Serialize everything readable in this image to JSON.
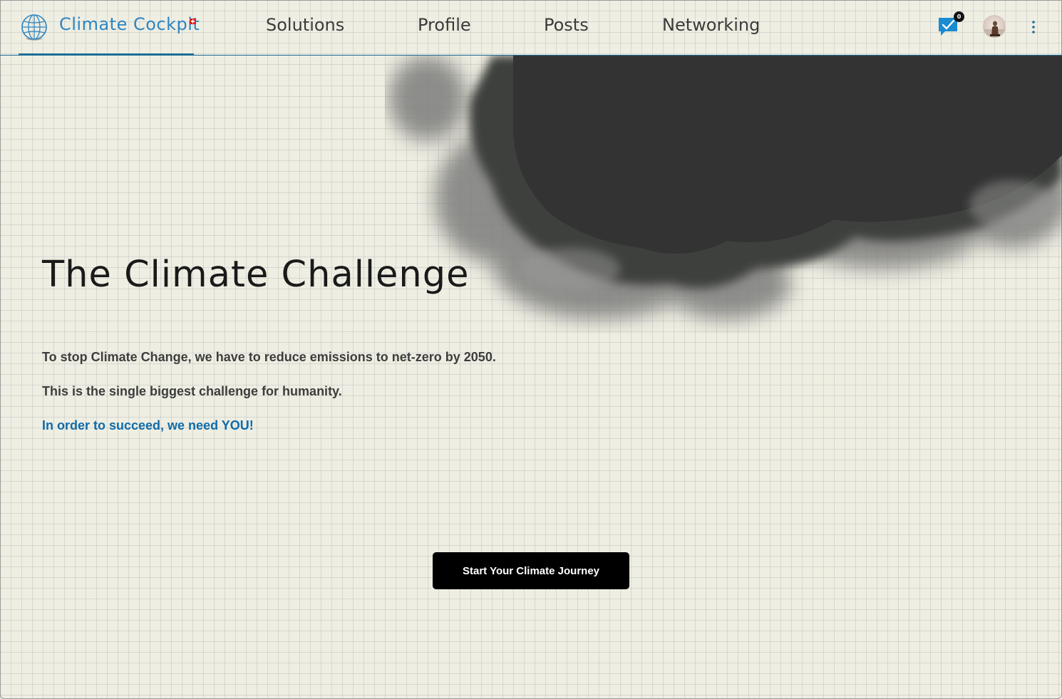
{
  "header": {
    "brand_name": "Climate Cockpit",
    "nav": [
      "Solutions",
      "Profile",
      "Posts",
      "Networking"
    ],
    "tasks_count": "0",
    "brand_color": "#2d86c2",
    "icons": [
      "globe-icon",
      "swiss-flag-icon",
      "chat-check-icon",
      "avatar",
      "more-vertical-icon"
    ]
  },
  "hero": {
    "title": "The Climate Challenge",
    "line1": "To stop Climate Change, we have to reduce emissions to net-zero by 2050.",
    "line2": "This is the single biggest challenge for humanity.",
    "line3": "In order to succeed, we need YOU!",
    "highlight_color": "#0f6cab",
    "cta_label": "Start Your Climate Journey"
  }
}
